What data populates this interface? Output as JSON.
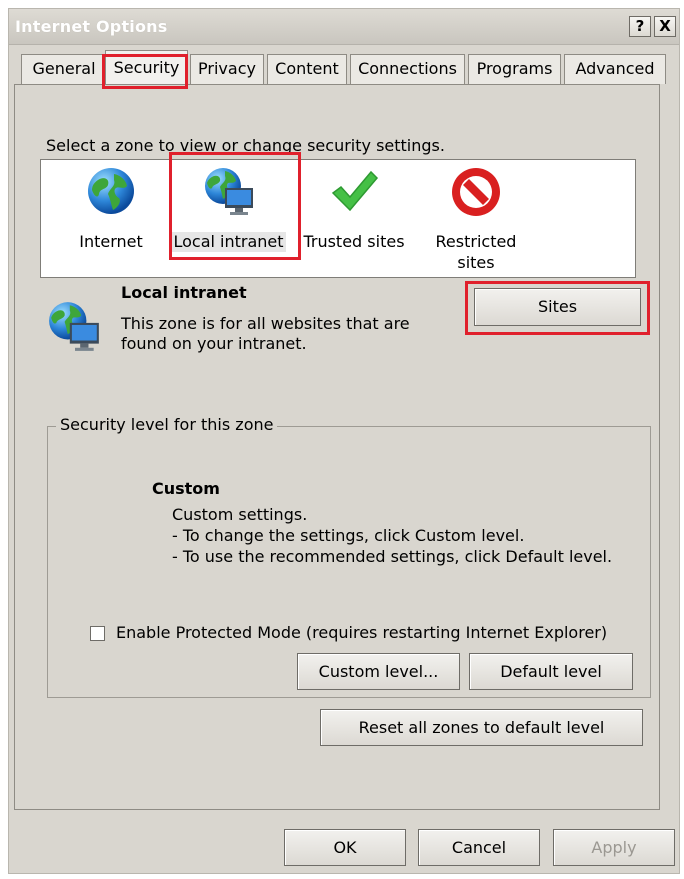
{
  "window": {
    "title": "Internet Options",
    "help_button": "?",
    "close_button": "X"
  },
  "tabs": [
    {
      "label": "General"
    },
    {
      "label": "Security",
      "selected": true
    },
    {
      "label": "Privacy"
    },
    {
      "label": "Content"
    },
    {
      "label": "Connections"
    },
    {
      "label": "Programs"
    },
    {
      "label": "Advanced"
    }
  ],
  "zones": {
    "prompt": "Select a zone to view or change security settings.",
    "items": [
      {
        "icon": "globe-icon",
        "label": "Internet"
      },
      {
        "icon": "local-intranet-icon",
        "label": "Local intranet",
        "selected": true
      },
      {
        "icon": "checkmark-icon",
        "label": "Trusted sites"
      },
      {
        "icon": "restricted-icon",
        "label_line1": "Restricted",
        "label_line2": "sites"
      }
    ]
  },
  "zone_info": {
    "title": "Local intranet",
    "desc_line1": "This zone is for all websites that are",
    "desc_line2": "found on your intranet.",
    "sites_button": "Sites"
  },
  "security_level": {
    "legend": "Security level for this zone",
    "level_title": "Custom",
    "line1": "Custom settings.",
    "line2": "- To change the settings, click Custom level.",
    "line3": "- To use the recommended settings, click Default level.",
    "protected_mode_label": "Enable Protected Mode (requires restarting Internet Explorer)",
    "protected_mode_checked": false,
    "custom_level_button": "Custom level...",
    "default_level_button": "Default level"
  },
  "reset_button": "Reset all zones to default level",
  "footer": {
    "ok": "OK",
    "cancel": "Cancel",
    "apply": "Apply"
  },
  "colors": {
    "highlight_red": "#e0202c",
    "dialog_bg": "#d9d6cf"
  }
}
